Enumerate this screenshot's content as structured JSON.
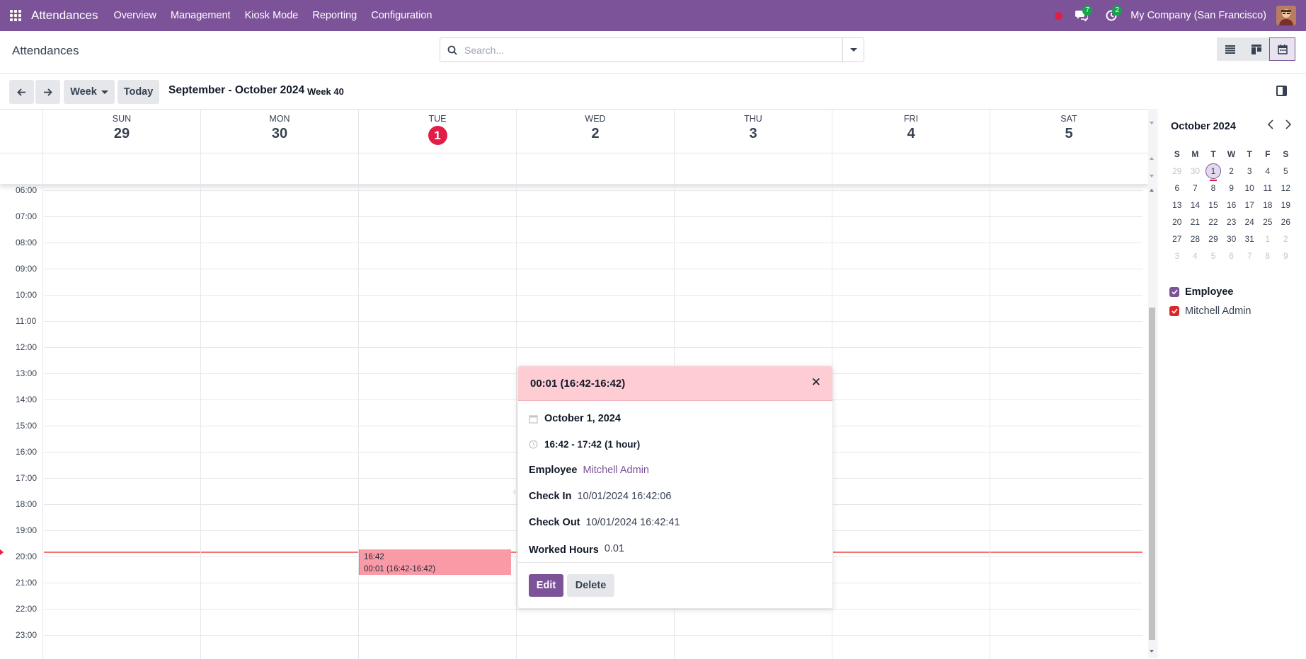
{
  "navbar": {
    "brand": "Attendances",
    "menu": [
      "Overview",
      "Management",
      "Kiosk Mode",
      "Reporting",
      "Configuration"
    ],
    "messages_count": "7",
    "activities_count": "2",
    "company": "My Company (San Francisco)"
  },
  "control_panel": {
    "title": "Attendances",
    "search_placeholder": "Search..."
  },
  "calendar_toolbar": {
    "week_button": "Week",
    "today_button": "Today",
    "range_label": "September - October 2024",
    "week_label": "Week 40"
  },
  "calendar": {
    "days": [
      {
        "name": "SUN",
        "num": "29"
      },
      {
        "name": "MON",
        "num": "30"
      },
      {
        "name": "TUE",
        "num": "1",
        "today": true
      },
      {
        "name": "WED",
        "num": "2"
      },
      {
        "name": "THU",
        "num": "3"
      },
      {
        "name": "FRI",
        "num": "4"
      },
      {
        "name": "SAT",
        "num": "5"
      }
    ],
    "hours": [
      "06:00",
      "07:00",
      "08:00",
      "09:00",
      "10:00",
      "11:00",
      "12:00",
      "13:00",
      "14:00",
      "15:00",
      "16:00",
      "17:00",
      "18:00",
      "19:00",
      "20:00",
      "21:00",
      "22:00",
      "23:00"
    ],
    "event": {
      "time": "16:42",
      "title": "00:01 (16:42-16:42)"
    }
  },
  "popover": {
    "title": "00:01 (16:42-16:42)",
    "date": "October 1, 2024",
    "time_range": "16:42 - 17:42",
    "duration": "(1 hour)",
    "employee_label": "Employee",
    "employee_value": "Mitchell Admin",
    "check_in_label": "Check In",
    "check_in_value": "10/01/2024 16:42:06",
    "check_out_label": "Check Out",
    "check_out_value": "10/01/2024 16:42:41",
    "worked_hours_label": "Worked Hours",
    "worked_hours_value": "0.01",
    "edit_button": "Edit",
    "delete_button": "Delete"
  },
  "sidebar": {
    "month_title": "October 2024",
    "weekday_headers": [
      "S",
      "M",
      "T",
      "W",
      "T",
      "F",
      "S"
    ],
    "weeks": [
      [
        {
          "d": "29",
          "m": true
        },
        {
          "d": "30",
          "m": true
        },
        {
          "d": "1",
          "t": true
        },
        {
          "d": "2"
        },
        {
          "d": "3"
        },
        {
          "d": "4"
        },
        {
          "d": "5"
        }
      ],
      [
        {
          "d": "6"
        },
        {
          "d": "7"
        },
        {
          "d": "8"
        },
        {
          "d": "9"
        },
        {
          "d": "10"
        },
        {
          "d": "11"
        },
        {
          "d": "12"
        }
      ],
      [
        {
          "d": "13"
        },
        {
          "d": "14"
        },
        {
          "d": "15"
        },
        {
          "d": "16"
        },
        {
          "d": "17"
        },
        {
          "d": "18"
        },
        {
          "d": "19"
        }
      ],
      [
        {
          "d": "20"
        },
        {
          "d": "21"
        },
        {
          "d": "22"
        },
        {
          "d": "23"
        },
        {
          "d": "24"
        },
        {
          "d": "25"
        },
        {
          "d": "26"
        }
      ],
      [
        {
          "d": "27"
        },
        {
          "d": "28"
        },
        {
          "d": "29"
        },
        {
          "d": "30"
        },
        {
          "d": "31"
        },
        {
          "d": "1",
          "m": true
        },
        {
          "d": "2",
          "m": true
        }
      ],
      [
        {
          "d": "3",
          "m": true
        },
        {
          "d": "4",
          "m": true
        },
        {
          "d": "5",
          "m": true
        },
        {
          "d": "6",
          "m": true
        },
        {
          "d": "7",
          "m": true
        },
        {
          "d": "8",
          "m": true
        },
        {
          "d": "9",
          "m": true
        }
      ]
    ],
    "filter_header": "Employee",
    "filter_item": "Mitchell Admin"
  },
  "colors": {
    "brand": "#7c5399",
    "today": "#e11d48",
    "event": "#fb9aa7",
    "employee_checkbox": "#7c5399",
    "filter_item_checkbox": "#dc2626"
  }
}
